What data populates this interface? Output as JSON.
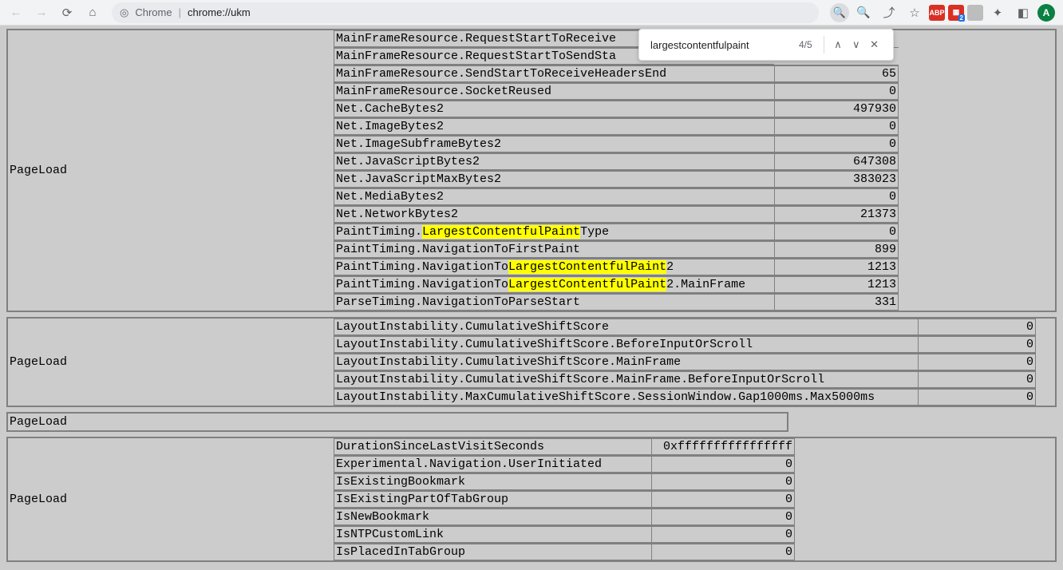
{
  "toolbar": {
    "address_prefix": "Chrome",
    "address_url": "chrome://ukm",
    "avatar_letter": "A",
    "ext_abp": "ABP",
    "ext_red_sub": "2"
  },
  "findbar": {
    "query": "largestcontentfulpaint",
    "count": "4/5"
  },
  "section1": {
    "label": "PageLoad",
    "keyWidth": 552,
    "valWidth": 156,
    "rows": [
      {
        "k": "MainFrameResource.RequestStartToReceive",
        "v": "",
        "cut": true
      },
      {
        "k": "MainFrameResource.RequestStartToSendSta",
        "v": "",
        "cut": true
      },
      {
        "k": "MainFrameResource.SendStartToReceiveHeadersEnd",
        "v": "65"
      },
      {
        "k": "MainFrameResource.SocketReused",
        "v": "0"
      },
      {
        "k": "Net.CacheBytes2",
        "v": "497930"
      },
      {
        "k": "Net.ImageBytes2",
        "v": "0"
      },
      {
        "k": "Net.ImageSubframeBytes2",
        "v": "0"
      },
      {
        "k": "Net.JavaScriptBytes2",
        "v": "647308"
      },
      {
        "k": "Net.JavaScriptMaxBytes2",
        "v": "383023"
      },
      {
        "k": "Net.MediaBytes2",
        "v": "0"
      },
      {
        "k": "Net.NetworkBytes2",
        "v": "21373"
      },
      {
        "k": "PaintTiming.",
        "hl": "LargestContentfulPaint",
        "k2": "Type",
        "v": "0"
      },
      {
        "k": "PaintTiming.NavigationToFirstPaint",
        "v": "899"
      },
      {
        "k": "PaintTiming.NavigationTo",
        "hl": "LargestContentfulPaint",
        "k2": "2",
        "v": "1213"
      },
      {
        "k": "PaintTiming.NavigationTo",
        "hl": "LargestContentfulPaint",
        "k2": "2.MainFrame",
        "v": "1213"
      },
      {
        "k": "ParseTiming.NavigationToParseStart",
        "v": "331"
      }
    ]
  },
  "section2": {
    "label": "PageLoad",
    "keyWidth": 732,
    "valWidth": 148,
    "rows": [
      {
        "k": "LayoutInstability.CumulativeShiftScore",
        "v": "0"
      },
      {
        "k": "LayoutInstability.CumulativeShiftScore.BeforeInputOrScroll",
        "v": "0"
      },
      {
        "k": "LayoutInstability.CumulativeShiftScore.MainFrame",
        "v": "0"
      },
      {
        "k": "LayoutInstability.CumulativeShiftScore.MainFrame.BeforeInputOrScroll",
        "v": "0"
      },
      {
        "k": "LayoutInstability.MaxCumulativeShiftScore.SessionWindow.Gap1000ms.Max5000ms",
        "v": "0"
      }
    ]
  },
  "section3": {
    "label": "PageLoad"
  },
  "section4": {
    "label": "PageLoad",
    "keyWidth": 398,
    "valWidth": 180,
    "rows": [
      {
        "k": "DurationSinceLastVisitSeconds",
        "v": "0xffffffffffffffff"
      },
      {
        "k": "Experimental.Navigation.UserInitiated",
        "v": "0"
      },
      {
        "k": "IsExistingBookmark",
        "v": "0"
      },
      {
        "k": "IsExistingPartOfTabGroup",
        "v": "0"
      },
      {
        "k": "IsNewBookmark",
        "v": "0"
      },
      {
        "k": "IsNTPCustomLink",
        "v": "0"
      },
      {
        "k": "IsPlacedInTabGroup",
        "v": "0"
      }
    ]
  }
}
